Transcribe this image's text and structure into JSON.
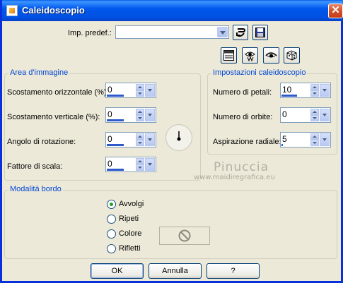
{
  "window": {
    "title": "Caleidoscopio",
    "close_label": "✕"
  },
  "preset": {
    "label": "Imp. predef.:",
    "value": ""
  },
  "image_area": {
    "title": "Area d'immagine",
    "fields": [
      {
        "label": "Scostamento orizzontale (%):",
        "value": "0",
        "level": 0.6
      },
      {
        "label": "Scostamento verticale (%):",
        "value": "0",
        "level": 0.6
      },
      {
        "label": "Angolo di rotazione:",
        "value": "0",
        "level": 0.6
      },
      {
        "label": "Fattore di scala:",
        "value": "0",
        "level": 0.6
      }
    ]
  },
  "kaleido_settings": {
    "title": "Impostazioni caleidoscopio",
    "fields": [
      {
        "label": "Numero di petali:",
        "value": "10",
        "level": 0.55
      },
      {
        "label": "Numero di orbite:",
        "value": "0",
        "level": 0.0
      },
      {
        "label": "Aspirazione radiale:",
        "value": "5",
        "level": 0.05
      }
    ]
  },
  "border_mode": {
    "title": "Modalità bordo",
    "options": [
      {
        "label": "Avvolgi",
        "checked": true
      },
      {
        "label": "Ripeti",
        "checked": false
      },
      {
        "label": "Colore",
        "checked": false
      },
      {
        "label": "Rifletti",
        "checked": false
      }
    ]
  },
  "watermark": {
    "line1": "Pinuccia",
    "line2": "www.maidiregrafica.eu"
  },
  "buttons": {
    "ok": "OK",
    "cancel": "Annulla",
    "help": "?"
  },
  "icons": {
    "title": "app-icon",
    "preset_actions": [
      "load-preset-icon",
      "save-preset-icon"
    ],
    "toolbar": [
      "preview-toggle-icon",
      "proof-icon",
      "eye-icon",
      "randomize-dice-icon"
    ],
    "dial": "rotation-dial-icon",
    "swatch": "no-color-icon"
  },
  "colors": {
    "titlebar": "#0058ee",
    "group_title": "#0046d5",
    "face": "#ece9d8",
    "accent_bar": "#2d59c9"
  }
}
